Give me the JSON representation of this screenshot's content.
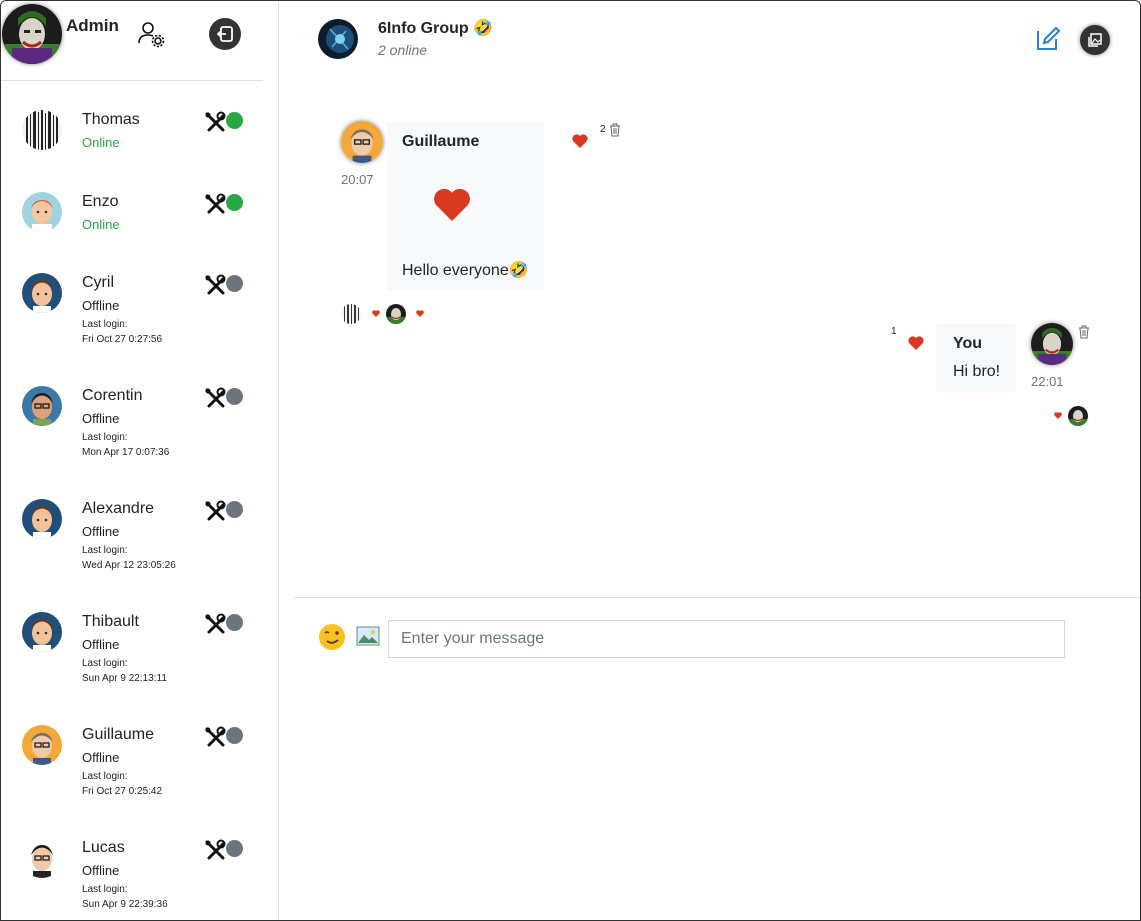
{
  "admin": {
    "name": "Admin"
  },
  "users": [
    {
      "name": "Thomas",
      "status": "Online",
      "online": true,
      "last_label": "",
      "last_login": "",
      "avatar": "barcode"
    },
    {
      "name": "Enzo",
      "status": "Online",
      "online": true,
      "last_label": "",
      "last_login": "",
      "avatar": "red-hair"
    },
    {
      "name": "Cyril",
      "status": "Offline",
      "online": false,
      "last_label": "Last login:",
      "last_login": "Fri Oct 27 0:27:56",
      "avatar": "brown-hair"
    },
    {
      "name": "Corentin",
      "status": "Offline",
      "online": false,
      "last_label": "Last login:",
      "last_login": "Mon Apr 17 0:07:36",
      "avatar": "glasses"
    },
    {
      "name": "Alexandre",
      "status": "Offline",
      "online": false,
      "last_label": "Last login:",
      "last_login": "Wed Apr 12 23:05:26",
      "avatar": "brown-hair"
    },
    {
      "name": "Thibault",
      "status": "Offline",
      "online": false,
      "last_label": "Last login:",
      "last_login": "Sun Apr 9 22:13:11",
      "avatar": "brown-hair"
    },
    {
      "name": "Guillaume",
      "status": "Offline",
      "online": false,
      "last_label": "Last login:",
      "last_login": "Fri Oct 27 0:25:42",
      "avatar": "gray-glasses"
    },
    {
      "name": "Lucas",
      "status": "Offline",
      "online": false,
      "last_label": "Last login:",
      "last_login": "Sun Apr 9 22:39:36",
      "avatar": "black-hair"
    }
  ],
  "chat": {
    "group_name": "6Info Group 🤣",
    "online_text": "2 online"
  },
  "messages": [
    {
      "author": "Guillaume",
      "time": "20:07",
      "text": "Hello everyone🤣",
      "reaction_count": "2"
    },
    {
      "author": "You",
      "time": "22:01",
      "text": "Hi bro!",
      "reaction_count": "1"
    }
  ],
  "composer": {
    "placeholder": "Enter your message"
  },
  "colors": {
    "online": "#28a745",
    "offline": "#6c757d",
    "heart": "#d9391e"
  }
}
